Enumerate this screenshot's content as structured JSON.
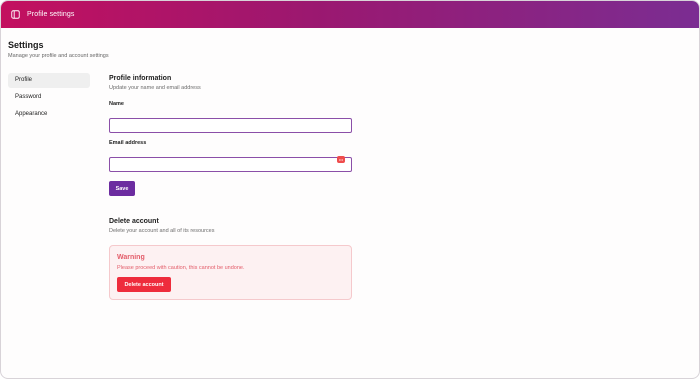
{
  "topbar": {
    "icon": "sidebar-toggle-icon",
    "title": "Profile settings"
  },
  "page": {
    "title": "Settings",
    "subtitle": "Manage your profile and account settings"
  },
  "sidebar": {
    "items": [
      {
        "label": "Profile",
        "active": true
      },
      {
        "label": "Password",
        "active": false
      },
      {
        "label": "Appearance",
        "active": false
      }
    ]
  },
  "profile": {
    "title": "Profile information",
    "subtitle": "Update your name and email address",
    "name_label": "Name",
    "name_value": "",
    "email_label": "Email address",
    "email_value": "",
    "email_icon": "password-manager-icon",
    "save_label": "Save"
  },
  "delete_account": {
    "title": "Delete account",
    "subtitle": "Delete your account and all of its resources",
    "warning_title": "Warning",
    "warning_text": "Please proceed with caution, this cannot be undone.",
    "button_label": "Delete account"
  },
  "colors": {
    "topbar_start": "#c3105f",
    "topbar_end": "#7b2d92",
    "primary": "#6c2ca0",
    "danger": "#ee2c3c",
    "warning_text": "#e35d6a"
  }
}
